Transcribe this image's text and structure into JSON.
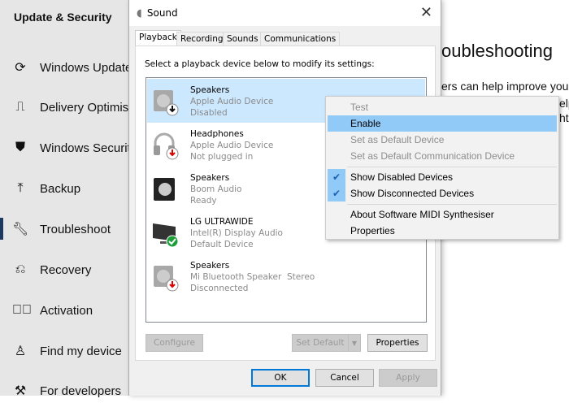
{
  "sidebar": {
    "title": "Update & Security",
    "items": [
      {
        "label": "Windows Update",
        "icon": "refresh-icon"
      },
      {
        "label": "Delivery Optimisa",
        "icon": "delivery-icon"
      },
      {
        "label": "Windows Security",
        "icon": "shield-icon"
      },
      {
        "label": "Backup",
        "icon": "upload-arrow-icon"
      },
      {
        "label": "Troubleshoot",
        "icon": "wrench-icon"
      },
      {
        "label": "Recovery",
        "icon": "recovery-icon"
      },
      {
        "label": "Activation",
        "icon": "check-circle-icon"
      },
      {
        "label": "Find my device",
        "icon": "person-location-icon"
      },
      {
        "label": "For developers",
        "icon": "tools-icon"
      }
    ],
    "selected": "Troubleshoot"
  },
  "content": {
    "heading": "oubleshooting",
    "line1": "ers can help improve you",
    "line2": "elp",
    "line3": "ht"
  },
  "dialog": {
    "title": "Sound",
    "close": "✕",
    "tabs": [
      "Playback",
      "Recording",
      "Sounds",
      "Communications"
    ],
    "active_tab": "Playback",
    "instruction": "Select a playback device below to modify its settings:",
    "devices": [
      {
        "name": "Speakers",
        "desc": "Apple Audio Device",
        "status": "Disabled",
        "icon": "speaker-disabled-icon"
      },
      {
        "name": "Headphones",
        "desc": "Apple Audio Device",
        "status": "Not plugged in",
        "icon": "headphones-icon"
      },
      {
        "name": "Speakers",
        "desc": "Boom Audio",
        "status": "Ready",
        "icon": "speaker-icon"
      },
      {
        "name": "LG ULTRAWIDE",
        "desc": "Intel(R) Display Audio",
        "status": "Default Device",
        "icon": "monitor-icon"
      },
      {
        "name": "Speakers",
        "desc": "Mi Bluetooth Speaker  Stereo",
        "status": "Disconnected",
        "icon": "speaker-disconnected-icon"
      }
    ],
    "buttons": {
      "configure": "Configure",
      "set_default": "Set Default",
      "properties": "Properties",
      "ok": "OK",
      "cancel": "Cancel",
      "apply": "Apply"
    }
  },
  "context_menu": {
    "items": [
      {
        "label": "Test",
        "enabled": false
      },
      {
        "label": "Enable",
        "enabled": true,
        "highlighted": true
      },
      {
        "label": "Set as Default Device",
        "enabled": false
      },
      {
        "label": "Set as Default Communication Device",
        "enabled": false
      },
      {
        "label": "Show Disabled Devices",
        "checked": true
      },
      {
        "label": "Show Disconnected Devices",
        "checked": true
      },
      {
        "label": "About Software MIDI Synthesiser"
      },
      {
        "label": "Properties"
      }
    ]
  },
  "colors": {
    "selection": "#cce8ff",
    "menu_highlight": "#91c9f7",
    "accent": "#0078d7"
  }
}
